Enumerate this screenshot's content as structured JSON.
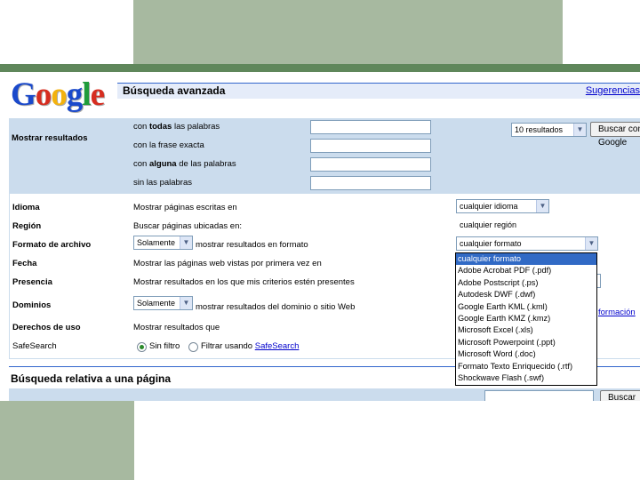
{
  "page": {
    "logo_text": "Google",
    "logo_colors": [
      "#1a49cb",
      "#d62d20",
      "#f3b20e",
      "#1a49cb",
      "#1f9c3b",
      "#d62d20"
    ],
    "title": "Búsqueda avanzada",
    "tips_link": "Sugerencias"
  },
  "results": {
    "label": "Mostrar resultados",
    "rows": [
      {
        "pre": "con ",
        "bold": "todas",
        "post": " las palabras"
      },
      {
        "pre": "con la frase exacta",
        "bold": "",
        "post": ""
      },
      {
        "pre": "con ",
        "bold": "alguna",
        "post": " de las palabras"
      },
      {
        "pre": "sin las palabras",
        "bold": "",
        "post": ""
      }
    ],
    "count_select": "10 resultados",
    "search_button": "Buscar con Google"
  },
  "options": {
    "language": {
      "label": "Idioma",
      "text": "Mostrar páginas escritas en",
      "select": "cualquier idioma"
    },
    "region": {
      "label": "Región",
      "text": "Buscar páginas ubicadas en:",
      "select": "cualquier región"
    },
    "format": {
      "label": "Formato de archivo",
      "mode": "Solamente",
      "text": "mostrar resultados en formato",
      "select": "cualquier formato"
    },
    "date": {
      "label": "Fecha",
      "text": "Mostrar las páginas web vistas por primera vez en"
    },
    "presence": {
      "label": "Presencia",
      "text": "Mostrar resultados en los que mis criterios estén presentes"
    },
    "domains": {
      "label": "Dominios",
      "mode": "Solamente",
      "text": "mostrar resultados del dominio o sitio Web",
      "more_info": "formación"
    },
    "usage": {
      "label": "Derechos de uso",
      "text": "Mostrar resultados que"
    },
    "safesearch": {
      "label": "SafeSearch",
      "off": "Sin filtro",
      "on_pre": "Filtrar usando ",
      "on_link": "SafeSearch",
      "selected": "off"
    }
  },
  "format_dropdown": {
    "options": [
      "cualquier formato",
      "Adobe Acrobat PDF (.pdf)",
      "Adobe Postscript (.ps)",
      "Autodesk DWF (.dwf)",
      "Google Earth KML (.kml)",
      "Google Earth KMZ (.kmz)",
      "Microsoft Excel (.xls)",
      "Microsoft Powerpoint (.ppt)",
      "Microsoft Word (.doc)",
      "Formato Texto Enriquecido (.rtf)",
      "Shockwave Flash (.swf)"
    ],
    "selected_index": 0
  },
  "related": {
    "title": "Búsqueda relativa a una página",
    "button": "Buscar"
  }
}
